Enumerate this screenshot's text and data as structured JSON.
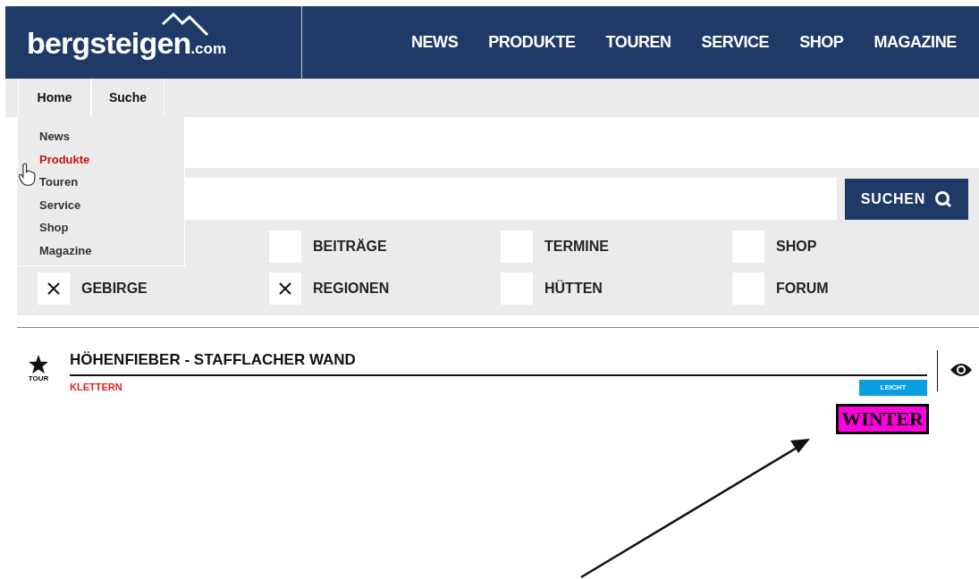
{
  "header": {
    "logo": "bergsteigen",
    "logo_suffix": ".com",
    "nav": [
      "NEWS",
      "PRODUKTE",
      "TOUREN",
      "SERVICE",
      "SHOP",
      "MAGAZINE"
    ]
  },
  "subnav": {
    "tabs": [
      "Home",
      "Suche"
    ]
  },
  "dropdown": {
    "items": [
      {
        "label": "News",
        "selected": false
      },
      {
        "label": "Produkte",
        "selected": true
      },
      {
        "label": "Touren",
        "selected": false
      },
      {
        "label": "Service",
        "selected": false
      },
      {
        "label": "Shop",
        "selected": false
      },
      {
        "label": "Magazine",
        "selected": false
      }
    ]
  },
  "search": {
    "button": "SUCHEN"
  },
  "filters": [
    [
      {
        "label": "BEITRÄGE",
        "checked": false
      },
      {
        "label": "TERMINE",
        "checked": false
      },
      {
        "label": "SHOP",
        "checked": false
      }
    ],
    [
      {
        "label": "GEBIRGE",
        "checked": true
      },
      {
        "label": "REGIONEN",
        "checked": true
      },
      {
        "label": "HÜTTEN",
        "checked": false
      },
      {
        "label": "FORUM",
        "checked": false
      }
    ]
  ],
  "result": {
    "type_label": "TOUR",
    "title": "HÖHENFIEBER - STAFFLACHER WAND",
    "category": "KLETTERN",
    "difficulty": "LEICHT",
    "season": "WINTER"
  }
}
